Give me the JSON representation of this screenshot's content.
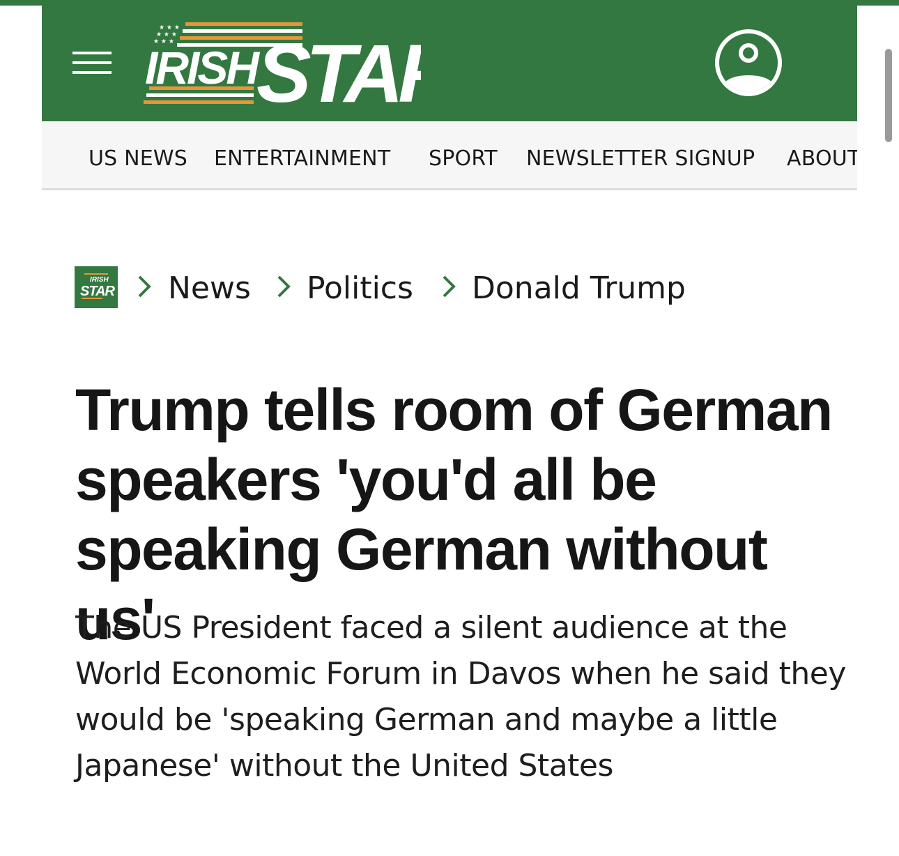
{
  "site": {
    "logo_text_irish": "IRISH",
    "logo_text_star": "STAR",
    "brand_color": "#337840",
    "accent_color": "#e8963c",
    "menu_icon": "hamburger-menu-icon",
    "account_icon": "user-account-icon"
  },
  "nav": {
    "items": [
      {
        "label": "US NEWS"
      },
      {
        "label": "ENTERTAINMENT"
      },
      {
        "label": "SPORT"
      },
      {
        "label": "NEWSLETTER SIGNUP"
      },
      {
        "label": "ABOUT"
      }
    ]
  },
  "breadcrumb": {
    "home_logo_top": "IRISH",
    "home_logo_bottom": "STAR",
    "items": [
      {
        "label": "News"
      },
      {
        "label": "Politics"
      },
      {
        "label": "Donald Trump"
      }
    ]
  },
  "article": {
    "headline": "Trump tells room of German speakers 'you'd all be speaking German without us'",
    "standfirst": "The US President faced a silent audience at the World Economic Forum in Davos when he said they would be 'speaking German and maybe a little Japanese' without the United States"
  }
}
